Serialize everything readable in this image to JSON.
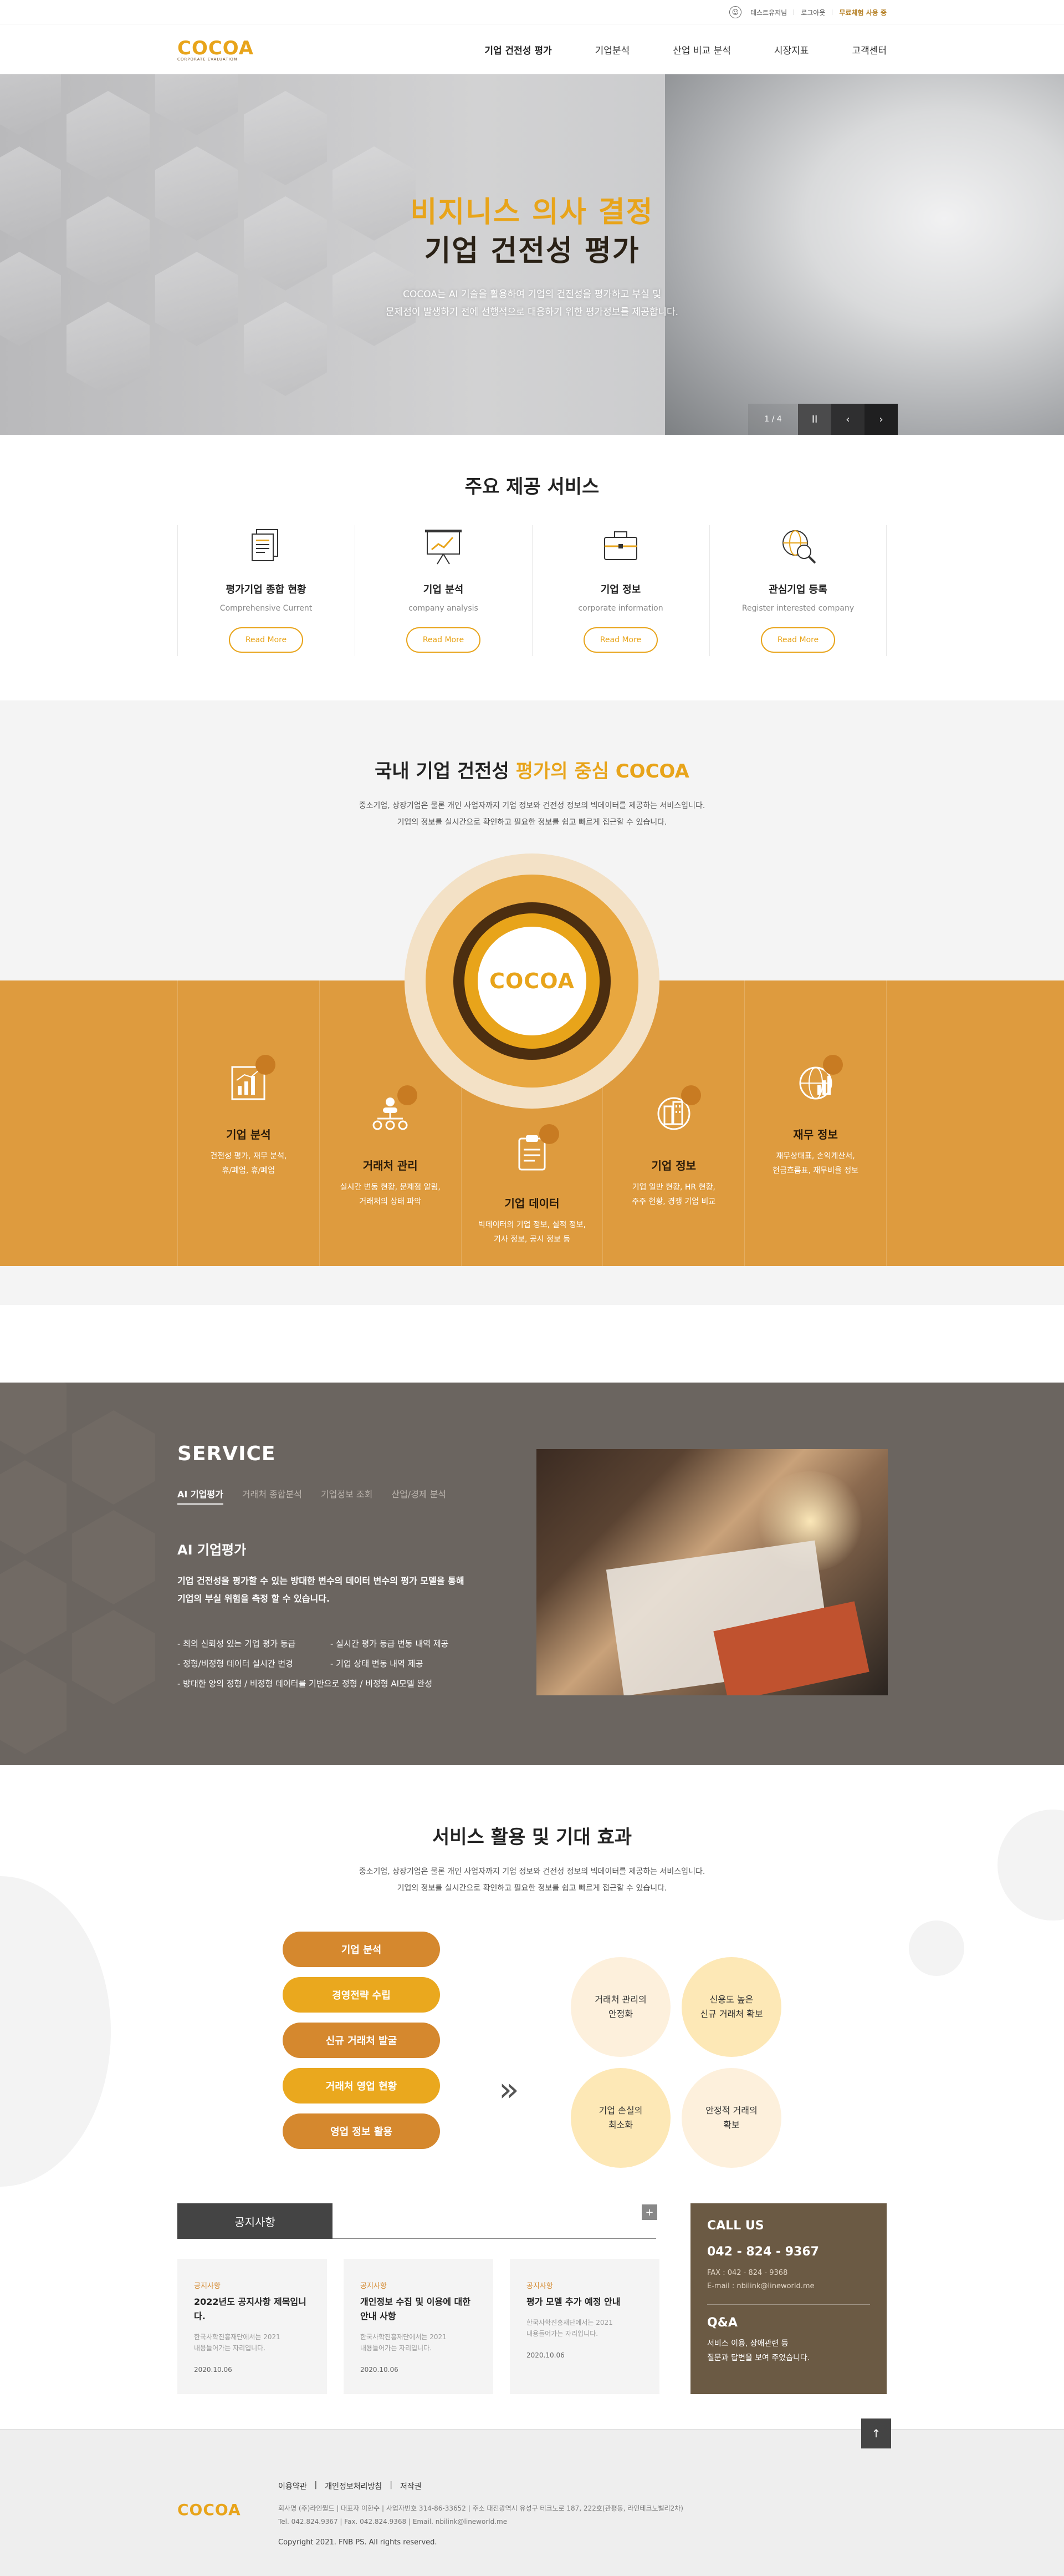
{
  "util": {
    "link1": "테스트유저님",
    "link2": "로그아웃",
    "link3": "무료체험 사용 중"
  },
  "header": {
    "logo": "COCOA",
    "logo_sub": "CORPORATE EVALUATION",
    "nav": [
      "기업 건전성 평가",
      "기업분석",
      "산업 비교 분석",
      "시장지표",
      "고객센터"
    ]
  },
  "hero": {
    "title1": "비지니스 의사 결정",
    "title2": "기업 건전성 평가",
    "desc1": "COCOA는 AI 기술을 활용하여 기업의 건전성을 평가하고 부실 및",
    "desc2": "문제점이 발생하기 전에 선행적으로 대응하기 위한 평가정보를 제공합니다.",
    "pager": "1 / 4",
    "pause": "II",
    "prev": "‹",
    "next": "›"
  },
  "services": {
    "title": "주요 제공 서비스",
    "items": [
      {
        "title": "평가기업 종합 현황",
        "en": "Comprehensive Current",
        "btn": "Read More",
        "icon": "document-stack-icon"
      },
      {
        "title": "기업 분석",
        "en": "company analysis",
        "btn": "Read More",
        "icon": "chart-board-icon"
      },
      {
        "title": "기업 정보",
        "en": "corporate information",
        "btn": "Read More",
        "icon": "briefcase-icon"
      },
      {
        "title": "관심기업 등록",
        "en": "Register interested company",
        "btn": "Read More",
        "icon": "globe-magnifier-icon"
      }
    ]
  },
  "center": {
    "title_a": "국내 기업 건전성 ",
    "title_b": "평가의 중심 COCOA",
    "desc1": "중소기업, 상장기업은 물론 개인 사업자까지 기업 정보와 건전성 정보의 빅데이터를 제공하는 서비스입니다.",
    "desc2": "기업의 정보를 실시간으로 확인하고 필요한 정보를 쉽고 빠르게 접근할 수 있습니다.",
    "logo": "COCOA",
    "cols": [
      {
        "title": "기업 분석",
        "l1": "건전성 평가, 재무 분석,",
        "l2": "휴/폐업, 휴/폐업"
      },
      {
        "title": "거래처 관리",
        "l1": "실시간 변동 현황, 문제점 알림,",
        "l2": "거래처의 상태 파악"
      },
      {
        "title": "기업 데이터",
        "l1": "빅데이터의 기업 정보, 실적 정보,",
        "l2": "기사 정보, 공시 정보 등"
      },
      {
        "title": "기업 정보",
        "l1": "기업 일반 현황, HR 현황,",
        "l2": "주주 현황, 경쟁 기업 비교"
      },
      {
        "title": "재무 정보",
        "l1": "재무상태표, 손익계산서,",
        "l2": "현금흐름표, 재무비율 정보"
      }
    ]
  },
  "service_dark": {
    "title": "SERVICE",
    "tabs": [
      "AI 기업평가",
      "거래처 종합분석",
      "기업정보 조회",
      "산업/경제 분석"
    ],
    "sub": "AI 기업평가",
    "lead1": "기업 건전성을 평가할 수 있는 방대한 변수의 데이터 변수의 평가 모델을 통해",
    "lead2": "기업의 부실 위험을 측정 할 수 있습니다.",
    "bullets": [
      "- 최의 신뢰성 있는 기업 평가 등급",
      "- 실시간 평가 등급 변동 내역 제공",
      "- 정형/비정형 데이터 실시간 변경",
      "- 기업 상태 변동 내역 제공",
      "- 방대한 양의 정형 / 비정형 데이터를 기반으로 정형 / 비정형 AI모델 완성"
    ]
  },
  "effects": {
    "title": "서비스 활용 및 기대 효과",
    "desc1": "중소기업, 상장기업은 물론 개인 사업자까지 기업 정보와 건전성 정보의 빅데이터를 제공하는 서비스입니다.",
    "desc2": "기업의 정보를 실시간으로 확인하고 필요한 정보를 쉽고 빠르게 접근할 수 있습니다.",
    "pills": [
      "기업 분석",
      "경영전략 수립",
      "신규 거래처 발굴",
      "거래처 영업 현황",
      "영업 정보 활용"
    ],
    "arrow": "»",
    "results": [
      [
        "거래처 관리의",
        "안정화"
      ],
      [
        "신용도 높은",
        "신규 거래처 확보"
      ],
      [
        "기업 손실의",
        "최소화"
      ],
      [
        "안정적 거래의",
        "확보"
      ]
    ]
  },
  "notice": {
    "title": "공지사항",
    "plus": "+",
    "cards": [
      {
        "cat": "공지사항",
        "title": "2022년도 공지사항 제목입니다.",
        "body1": "한국사학진흥재단에서는 2021",
        "body2": "내용들어가는 자리입니다.",
        "date": "2020.10.06"
      },
      {
        "cat": "공지사항",
        "title": "개인정보 수집 및 이용에 대한 안내 사항",
        "body1": "한국사학진흥재단에서는 2021",
        "body2": "내용들어가는 자리입니다.",
        "date": "2020.10.06"
      },
      {
        "cat": "공지사항",
        "title": "평가 모델 추가 예정 안내",
        "body1": "한국사학진흥재단에서는 2021",
        "body2": "내용들어가는 자리입니다.",
        "date": "2020.10.06"
      }
    ],
    "call": {
      "h": "CALL US",
      "tel": "042 - 824 - 9367",
      "fax": "FAX : 042 - 824 - 9368",
      "email": "E-mail : nbilink@lineworld.me",
      "qa": "Q&A",
      "qa1": "서비스 이용, 장애관련 등",
      "qa2": "질문과 답변을 보여 주었습니다."
    }
  },
  "footer": {
    "links": [
      "이용약관",
      "개인정보처리방침",
      "저작권"
    ],
    "info1": "회사명 (주)라인월드 | 대표자 이한수 | 사업자번호 314-86-33652 | 주소 대전광역시 유성구 테크노로 187, 222호(관평동, 라인테크노벨리2차)",
    "info2": "Tel. 042.824.9367 | Fax. 042.824.9368 | Email. nbilink@lineworld.me",
    "copy": "Copyright 2021. FNB PS. All rights reserved.",
    "logo": "COCOA",
    "top": "↑"
  }
}
